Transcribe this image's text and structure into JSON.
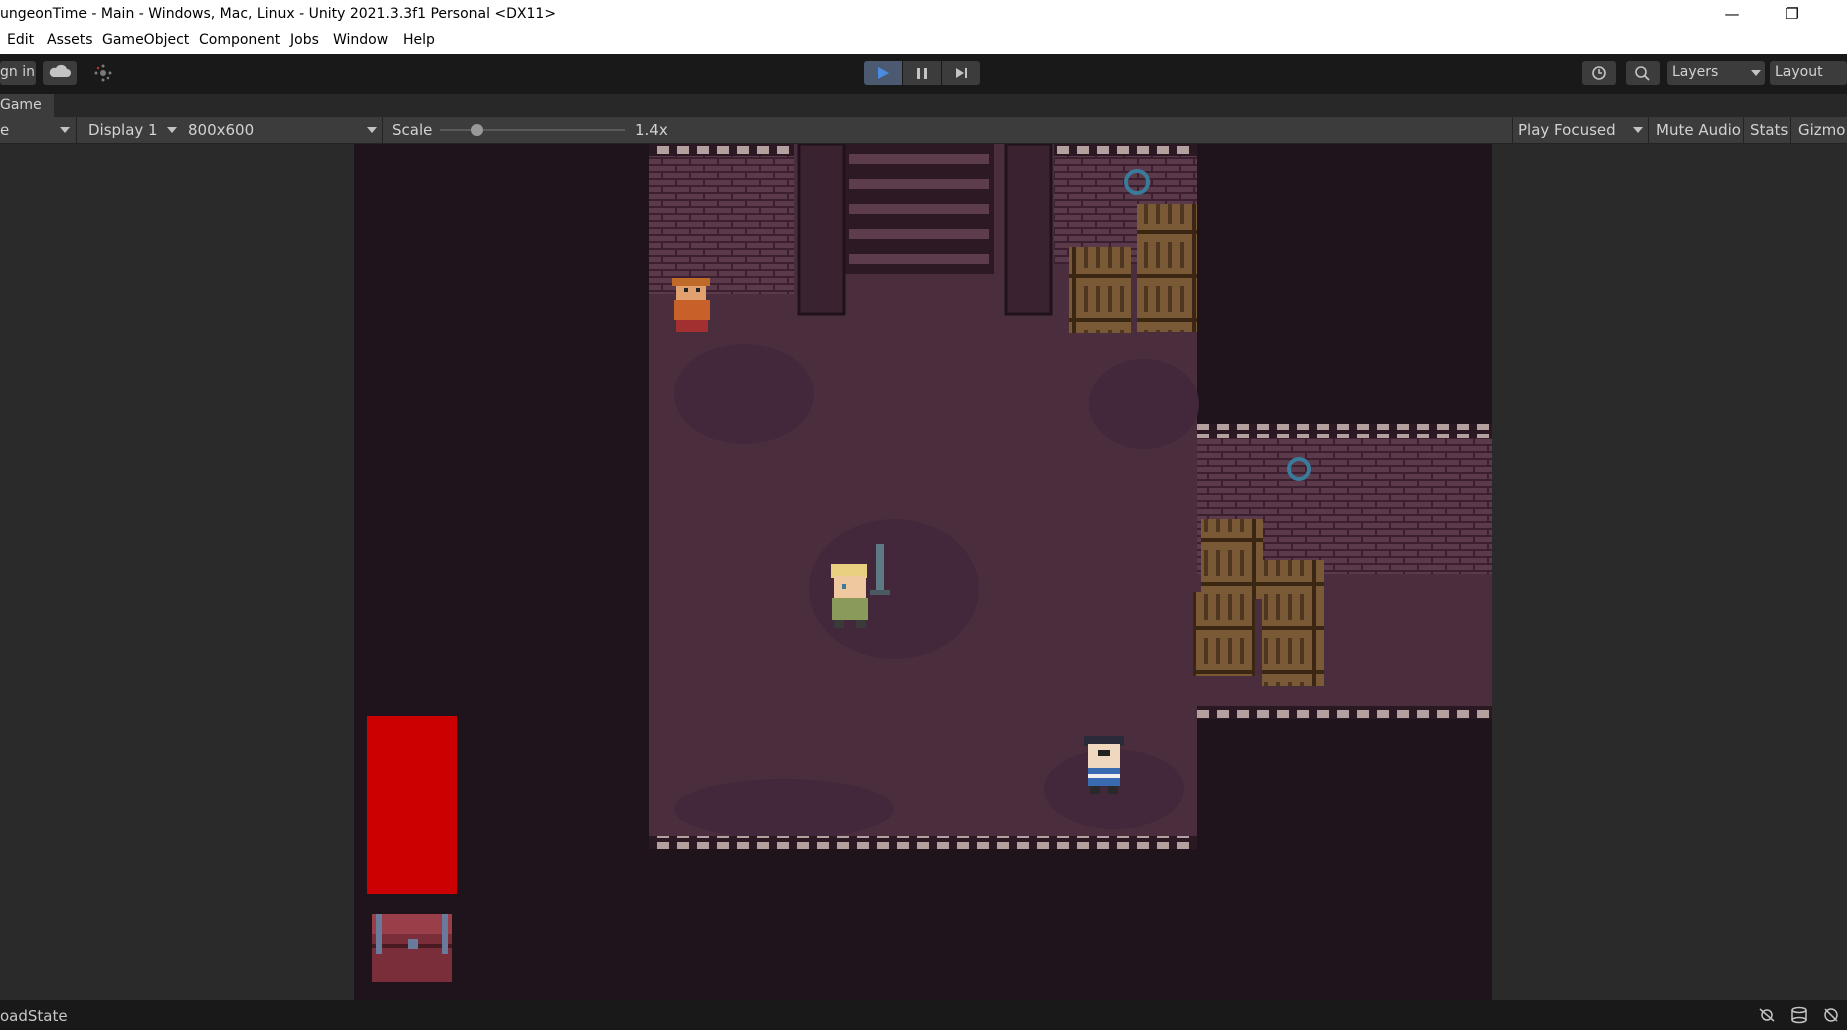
{
  "window": {
    "title": "ungeonTime - Main - Windows, Mac, Linux - Unity 2021.3.3f1 Personal <DX11>",
    "minimize_glyph": "—",
    "restore_glyph": "❐"
  },
  "menu": [
    "Edit",
    "Assets",
    "GameObject",
    "Component",
    "Jobs",
    "Window",
    "Help"
  ],
  "toolbar": {
    "sign_in_label": "gn in",
    "layers_label": "Layers",
    "layout_label": "Layout"
  },
  "game_tab": {
    "label": "Game"
  },
  "game_bar": {
    "game_mode_fragment": "e",
    "display_label": "Display 1",
    "resolution_label": "800x600",
    "scale_label": "Scale",
    "scale_value": "1.4x",
    "scale_slider_fraction": 0.2,
    "play_focused_label": "Play Focused",
    "mute_audio_label": "Mute Audio",
    "stats_label": "Stats",
    "gizmos_label": "Gizmo"
  },
  "status": {
    "text": "oadState"
  },
  "colors": {
    "accent_play": "#4b8ce0",
    "health_bar": "#cc0000",
    "dungeon_floor": "#4a2e3e",
    "void": "#1f141c",
    "crate": "#7a5a36"
  },
  "icons": {
    "cloud": "cloud-icon",
    "collab": "collab-icon",
    "play": "play-icon",
    "pause": "pause-icon",
    "step": "step-icon",
    "history": "history-icon",
    "search": "search-icon"
  }
}
